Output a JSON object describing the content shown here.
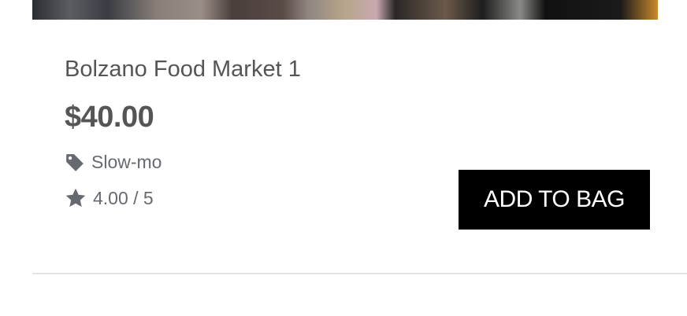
{
  "product": {
    "title": "Bolzano Food Market 1",
    "price": "$40.00",
    "tag": "Slow-mo",
    "rating": "4.00 / 5",
    "add_to_bag_label": "ADD TO BAG"
  },
  "icons": {
    "tag": "tag-icon",
    "rating": "star-icon"
  },
  "colors": {
    "button_bg": "#000000",
    "text": "#555555",
    "icon": "#666a70"
  }
}
